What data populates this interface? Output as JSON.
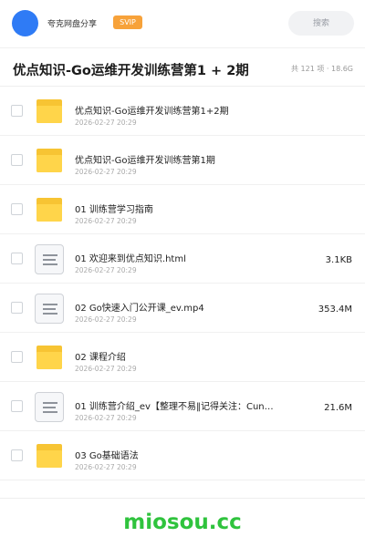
{
  "header": {
    "app_name": "夸克网盘分享",
    "badge": "SVIP",
    "search_placeholder": "搜索"
  },
  "title": "优点知识-Go运维开发训练营第1 + 2期",
  "summary": "共 121 项 · 18.6G",
  "files": [
    {
      "type": "folder",
      "name": "优点知识-Go运维开发训练营第1+2期",
      "date": "2026-02-27 20:29",
      "size": ""
    },
    {
      "type": "folder",
      "name": "优点知识-Go运维开发训练营第1期",
      "date": "2026-02-27 20:29",
      "size": ""
    },
    {
      "type": "folder",
      "name": "01 训练营学习指南",
      "date": "2026-02-27 20:29",
      "size": ""
    },
    {
      "type": "file",
      "name": "01 欢迎来到优点知识.html",
      "date": "2026-02-27 20:29",
      "size": "3.1KB"
    },
    {
      "type": "file",
      "name": "02 Go快速入门公开课_ev.mp4",
      "date": "2026-02-27 20:29",
      "size": "353.4M"
    },
    {
      "type": "folder",
      "name": "02 课程介绍",
      "date": "2026-02-27 20:29",
      "size": ""
    },
    {
      "type": "file",
      "name": "01 训练营介绍_ev【整理不易‖记得关注：Cun…",
      "date": "2026-02-27 20:29",
      "size": "21.6M"
    },
    {
      "type": "folder",
      "name": "03 Go基础语法",
      "date": "2026-02-27 20:29",
      "size": ""
    }
  ],
  "watermark": "miosou.cc",
  "colors": {
    "avatar": "#2f7bf5",
    "badge": "#f7a23a",
    "folder": "#ffd54a",
    "watermark": "#2fc33d"
  }
}
